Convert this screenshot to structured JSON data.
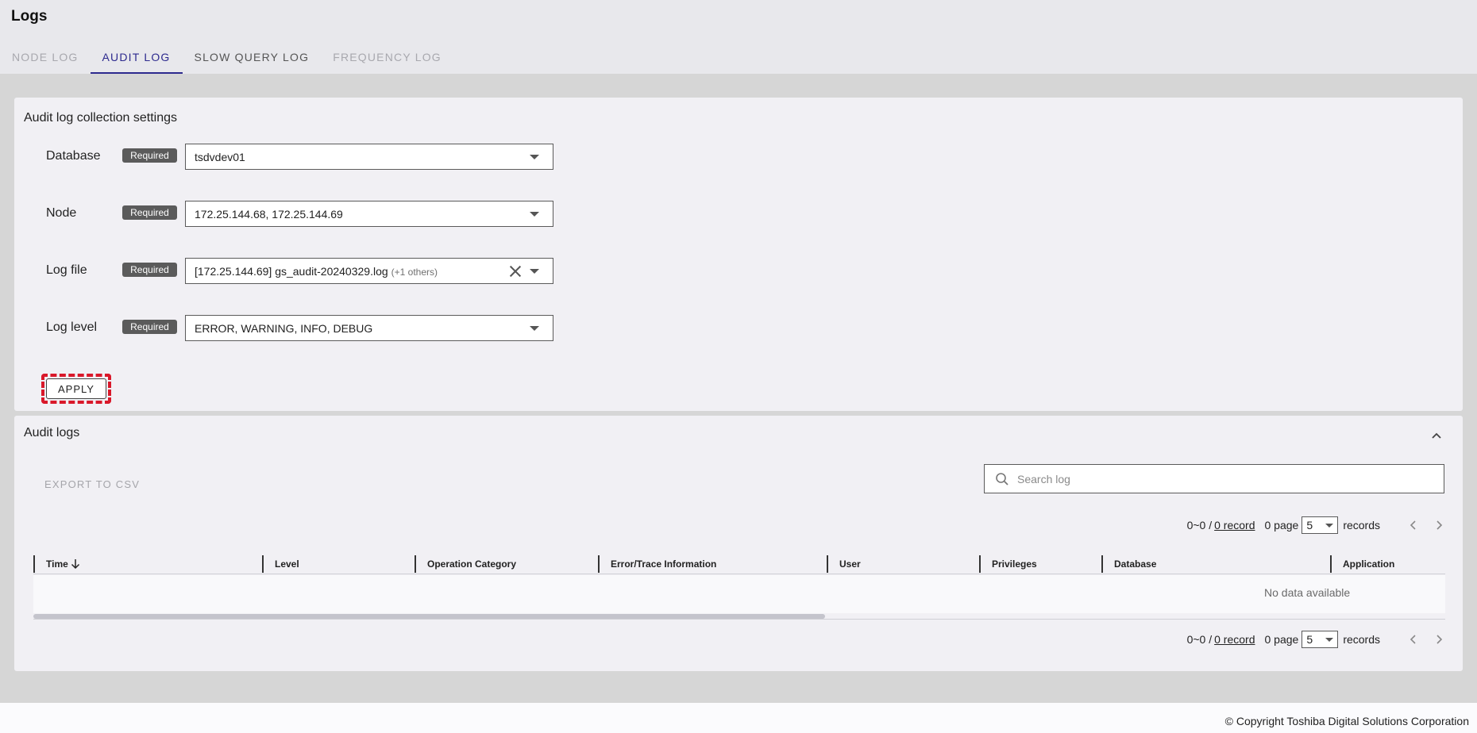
{
  "page": {
    "title": "Logs"
  },
  "tabs": [
    {
      "label": "NODE LOG",
      "state": "disabled"
    },
    {
      "label": "AUDIT LOG",
      "state": "active"
    },
    {
      "label": "SLOW QUERY LOG",
      "state": "normal"
    },
    {
      "label": "FREQUENCY LOG",
      "state": "disabled"
    }
  ],
  "settings": {
    "title": "Audit log collection settings",
    "required_label": "Required",
    "database": {
      "label": "Database",
      "value": "tsdvdev01"
    },
    "node": {
      "label": "Node",
      "value": "172.25.144.68, 172.25.144.69"
    },
    "logfile": {
      "label": "Log file",
      "value": "[172.25.144.69] gs_audit-20240329.log",
      "extra": "(+1 others)"
    },
    "loglevel": {
      "label": "Log level",
      "value": "ERROR, WARNING, INFO, DEBUG"
    },
    "apply_label": "APPLY"
  },
  "audit_logs": {
    "title": "Audit logs",
    "export_label": "EXPORT TO CSV",
    "search_placeholder": "Search log",
    "pager": {
      "range": "0~0 /",
      "record_link": "0 record",
      "page_text": "0 page",
      "per_page": "5",
      "records_label": "records"
    },
    "columns": [
      "Time",
      "Level",
      "Operation Category",
      "Error/Trace Information",
      "User",
      "Privileges",
      "Database",
      "Application"
    ],
    "empty_text": "No data available"
  },
  "footer": {
    "copyright": "© Copyright Toshiba Digital Solutions Corporation"
  },
  "colors": {
    "accent": "#2d2a8e",
    "highlight": "#d9182a",
    "badge": "#5b5b5b"
  }
}
